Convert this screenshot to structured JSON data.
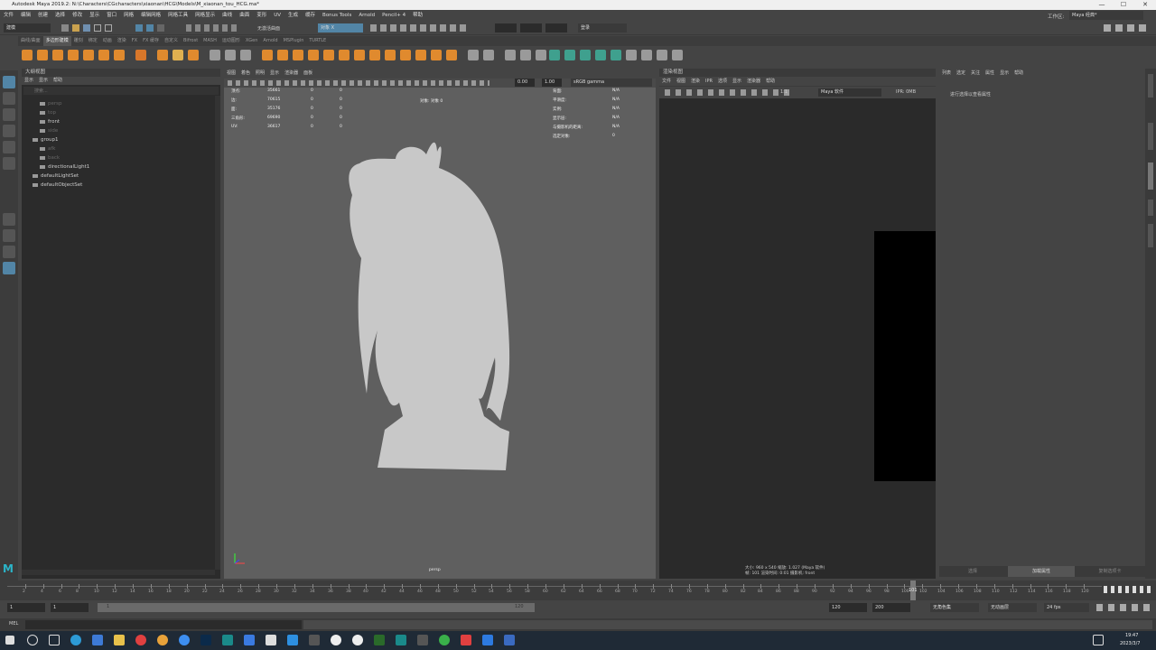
{
  "titlebar": {
    "title": "Autodesk Maya 2019.2: N:\\Characters\\CGcharacters\\xiaonan\\HCG\\Models\\M_xiaonan_tou_HCG.ma*",
    "minimize": "—",
    "maximize": "☐",
    "close": "✕"
  },
  "menubar": {
    "items": [
      "文件",
      "编辑",
      "创建",
      "选择",
      "修改",
      "显示",
      "窗口",
      "网格",
      "编辑网格",
      "网格工具",
      "网格显示",
      "曲线",
      "曲面",
      "变形",
      "UV",
      "生成",
      "缓存",
      "Bonus Tools",
      "Arnold",
      "Pencil+ 4",
      "帮助"
    ],
    "workspace_label": "工作区:",
    "workspace_value": "Maya 经典*"
  },
  "statusline": {
    "mode": "建模",
    "live_surface": "无激活曲面",
    "symmetry": "对象 X",
    "login": "登录"
  },
  "shelf": {
    "tabs": [
      "曲线/曲面",
      "多边形建模",
      "雕刻",
      "绑定",
      "动画",
      "渲染",
      "FX",
      "FX 缓存",
      "自定义",
      "Bifrost",
      "MASH",
      "运动图形",
      "XGen",
      "Arnold",
      "MSPlugin",
      "TURTLE"
    ],
    "active_tab": "多边形建模"
  },
  "outliner": {
    "title": "大纲视图",
    "menu": [
      "显示",
      "显示",
      "帮助"
    ],
    "search_placeholder": "搜索...",
    "items": [
      {
        "label": "persp",
        "dim": true,
        "indent": 1
      },
      {
        "label": "top",
        "dim": true,
        "indent": 1
      },
      {
        "label": "front",
        "dim": false,
        "indent": 1
      },
      {
        "label": "side",
        "dim": true,
        "indent": 1
      },
      {
        "label": "group1",
        "dim": false,
        "indent": 0
      },
      {
        "label": "afk",
        "dim": true,
        "indent": 1
      },
      {
        "label": "back",
        "dim": true,
        "indent": 1
      },
      {
        "label": "directionalLight1",
        "dim": false,
        "indent": 1
      },
      {
        "label": "defaultLightSet",
        "dim": false,
        "indent": 0
      },
      {
        "label": "defaultObjectSet",
        "dim": false,
        "indent": 0
      }
    ]
  },
  "viewport": {
    "menu": [
      "视图",
      "着色",
      "照明",
      "显示",
      "渲染器",
      "面板"
    ],
    "exposure": "0.00",
    "gamma": "1.00",
    "color_space": "sRGB gamma",
    "camera_label": "persp",
    "hud_left": [
      {
        "label": "顶点:",
        "v1": "35661",
        "v2": "0",
        "v3": "0"
      },
      {
        "label": "边:",
        "v1": "70615",
        "v2": "0",
        "v3": "0"
      },
      {
        "label": "面:",
        "v1": "35176",
        "v2": "0",
        "v3": "0"
      },
      {
        "label": "三角形:",
        "v1": "69690",
        "v2": "0",
        "v3": "0"
      },
      {
        "label": "UV:",
        "v1": "36617",
        "v2": "0",
        "v3": "0"
      }
    ],
    "hud_center": "对象: 对象 0",
    "hud_right": [
      {
        "label": "背面:",
        "value": "N/A"
      },
      {
        "label": "平滑度:",
        "value": "N/A"
      },
      {
        "label": "实例:",
        "value": "N/A"
      },
      {
        "label": "显示层:",
        "value": "N/A"
      },
      {
        "label": "与摄影机的距离:",
        "value": "N/A"
      },
      {
        "label": "选定对象:",
        "value": "0"
      }
    ]
  },
  "render_view": {
    "title": "渲染视图",
    "menu": [
      "文件",
      "视图",
      "渲染",
      "IPR",
      "选项",
      "显示",
      "渲染器",
      "帮助"
    ],
    "renderer": "Maya 软件",
    "ratio": "1:1",
    "ipr_info": "IPR: 0MB",
    "footer_line1": "大小: 960 x 540  缩放: 1.027     (Maya 软件)",
    "footer_line2": "帧: 101     渲染时间: 0:01     摄影机: front"
  },
  "attribute_editor": {
    "menu": [
      "列表",
      "选定",
      "关注",
      "属性",
      "显示",
      "帮助"
    ],
    "hint": "进行选择以查看属性",
    "buttons": [
      "选择",
      "加载属性",
      "复制选项卡"
    ]
  },
  "timeline": {
    "ticks": [
      "2",
      "4",
      "6",
      "8",
      "10",
      "12",
      "14",
      "16",
      "18",
      "20",
      "22",
      "24",
      "26",
      "28",
      "30",
      "32",
      "34",
      "36",
      "38",
      "40",
      "42",
      "44",
      "46",
      "48",
      "50",
      "52",
      "54",
      "56",
      "58",
      "60",
      "62",
      "64",
      "66",
      "68",
      "70",
      "72",
      "74",
      "76",
      "78",
      "80",
      "82",
      "84",
      "86",
      "88",
      "90",
      "92",
      "94",
      "96",
      "98",
      "100",
      "102",
      "104",
      "106",
      "108",
      "110",
      "112",
      "114",
      "116",
      "118",
      "120"
    ],
    "current_frame": "101"
  },
  "range": {
    "start": "1",
    "start_inner": "1",
    "range_start_label": "1",
    "range_end_label": "120",
    "end_inner": "120",
    "end": "200",
    "char_set": "无角色集",
    "anim_layer": "无动画层",
    "fps": "24 fps"
  },
  "cmdline": {
    "label": "MEL"
  },
  "taskbar": {
    "time": "19:47",
    "date": "2023/3/7"
  },
  "colors": {
    "accent_orange": "#e08a2e",
    "accent_blue": "#5285a6",
    "silhouette": "#c8c8c8"
  }
}
